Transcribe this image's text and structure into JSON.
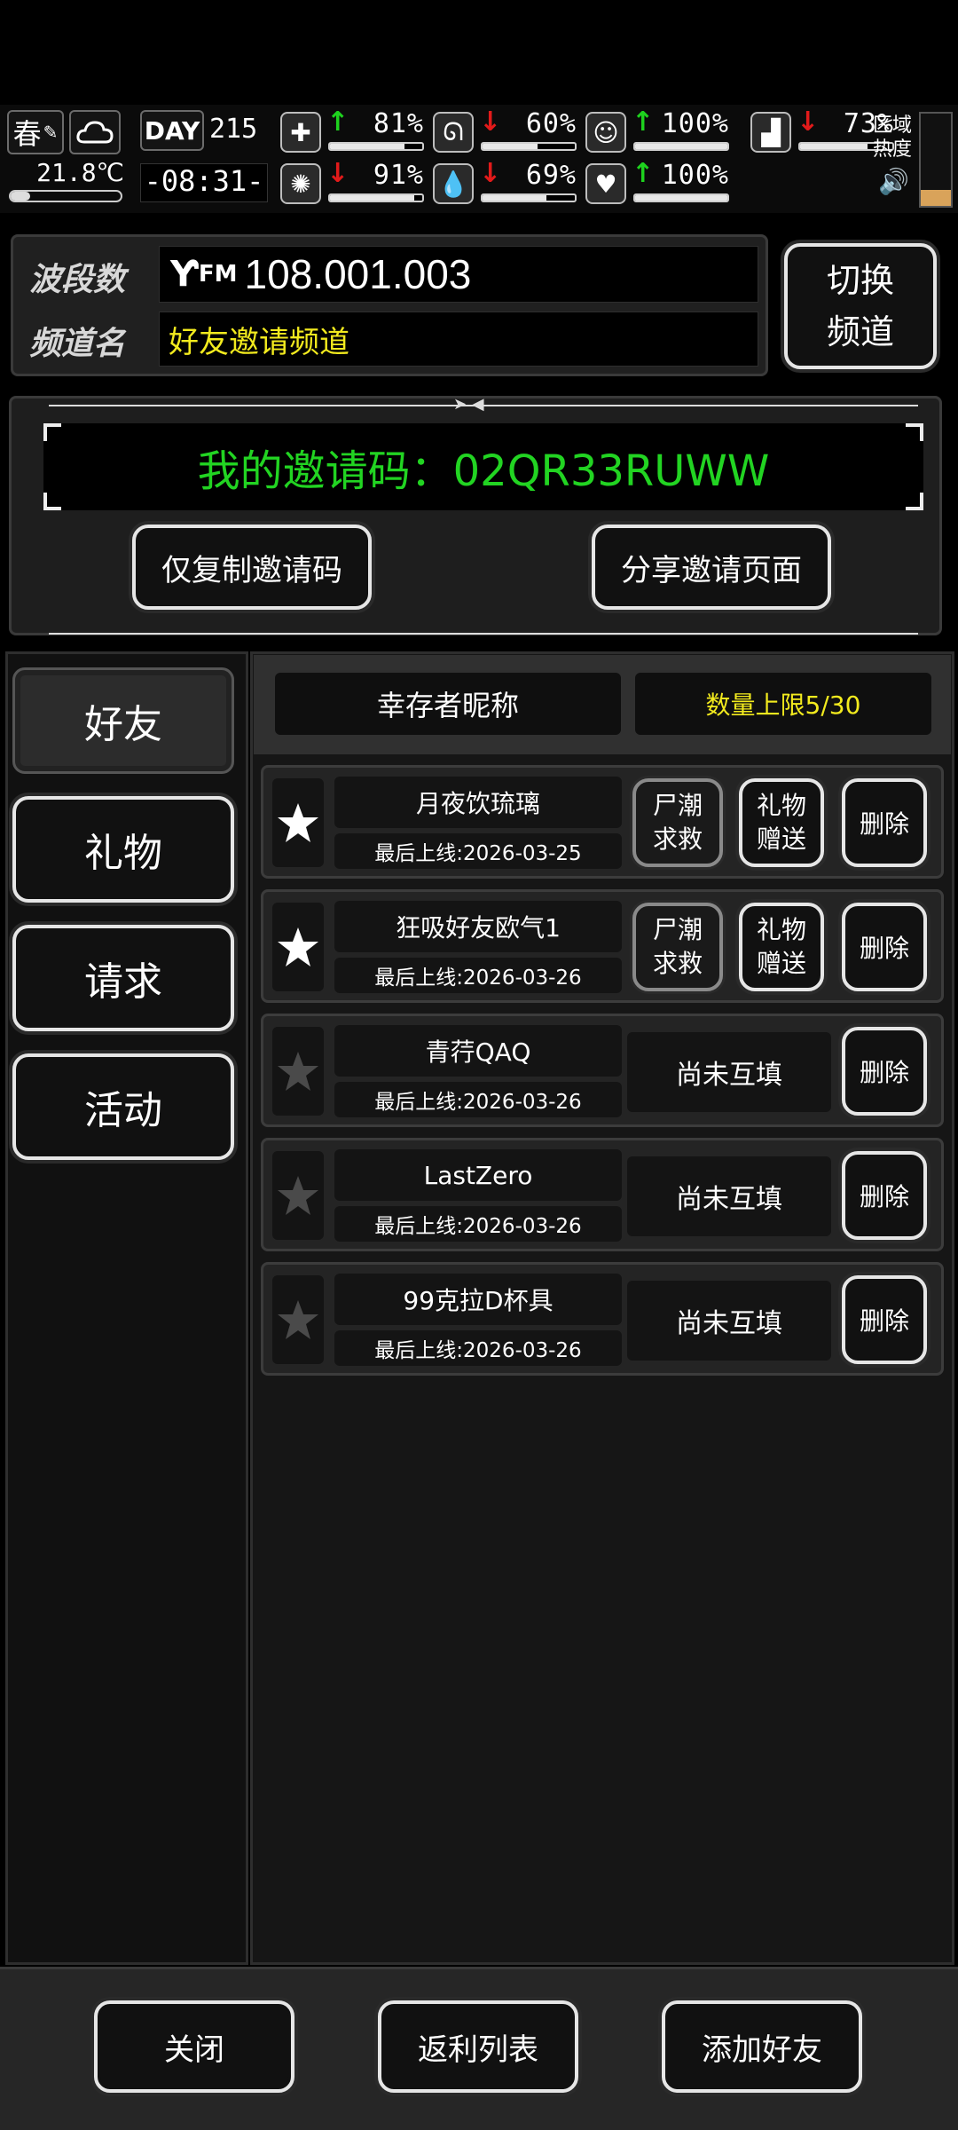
{
  "status": {
    "season": "春",
    "temperature": "21.8℃",
    "day_label": "DAY",
    "day_number": "215",
    "clock": "-08:31-",
    "stats": [
      {
        "icon": "medkit-icon",
        "trend": "up",
        "percent": "81%",
        "level": 0.81
      },
      {
        "icon": "stomach-icon",
        "trend": "down",
        "percent": "60%",
        "level": 0.6
      },
      {
        "icon": "mood-icon",
        "trend": "up",
        "percent": "100%",
        "level": 1.0
      },
      {
        "icon": "brain-icon",
        "trend": "down",
        "percent": "91%",
        "level": 0.91
      },
      {
        "icon": "water-drop-icon",
        "trend": "down",
        "percent": "69%",
        "level": 0.69
      },
      {
        "icon": "heart-icon",
        "trend": "up",
        "percent": "100%",
        "level": 1.0
      },
      {
        "icon": "boot-icon",
        "trend": "down",
        "percent": "73%",
        "level": 0.73
      }
    ],
    "zone_heat_label_1": "区域",
    "zone_heat_label_2": "热度"
  },
  "radio": {
    "band_label": "波段数",
    "band_value": "108.001.003",
    "channel_label": "频道名",
    "channel_value": "好友邀请频道",
    "switch_button_line1": "切换",
    "switch_button_line2": "频道"
  },
  "invite": {
    "code_text": "我的邀请码：02QR33RUWW",
    "copy_button": "仅复制邀请码",
    "share_button": "分享邀请页面"
  },
  "tabs": [
    {
      "label": "好友",
      "active": true
    },
    {
      "label": "礼物",
      "active": false
    },
    {
      "label": "请求",
      "active": false
    },
    {
      "label": "活动",
      "active": false
    }
  ],
  "friends_header": {
    "nickname_col": "幸存者昵称",
    "limit_text": "数量上限5/30"
  },
  "friends": [
    {
      "name": "月夜饮琉璃",
      "last_online": "最后上线:2026-03-25",
      "starred": true,
      "mutual": true,
      "rescue_line1": "尸潮",
      "rescue_line2": "求救",
      "gift_line1": "礼物",
      "gift_line2": "赠送",
      "delete": "删除"
    },
    {
      "name": "狂吸好友欧气1",
      "last_online": "最后上线:2026-03-26",
      "starred": true,
      "mutual": true,
      "rescue_line1": "尸潮",
      "rescue_line2": "求救",
      "gift_line1": "礼物",
      "gift_line2": "赠送",
      "delete": "删除"
    },
    {
      "name": "青荇QAQ",
      "last_online": "最后上线:2026-03-26",
      "starred": false,
      "mutual": false,
      "status": "尚未互填",
      "delete": "删除"
    },
    {
      "name": "LastZero",
      "last_online": "最后上线:2026-03-26",
      "starred": false,
      "mutual": false,
      "status": "尚未互填",
      "delete": "删除"
    },
    {
      "name": "99克拉D杯具",
      "last_online": "最后上线:2026-03-26",
      "starred": false,
      "mutual": false,
      "status": "尚未互填",
      "delete": "删除"
    }
  ],
  "bottom": {
    "close": "关闭",
    "rebate": "返利列表",
    "add_friend": "添加好友"
  },
  "colors": {
    "invite_green": "#22d422",
    "channel_yellow": "#f2ea1e",
    "limit_yellow": "#f2ea1e"
  }
}
